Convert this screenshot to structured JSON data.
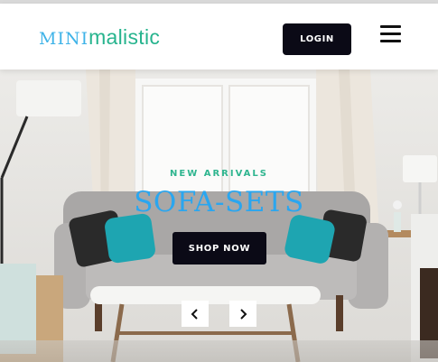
{
  "brand": {
    "logo_part1": "MINI",
    "logo_part2": "malistic"
  },
  "header": {
    "login_label": "LOGIN",
    "menu_icon": "hamburger-menu-icon"
  },
  "hero": {
    "eyebrow": "NEW ARRIVALS",
    "title": "SOFA-SETS",
    "cta_label": "SHOP NOW",
    "prev_icon": "chevron-left-icon",
    "next_icon": "chevron-right-icon"
  },
  "colors": {
    "logo_mini": "#3fb3e8",
    "logo_malistic": "#27b48e",
    "eyebrow": "#2fb58f",
    "title": "#2aa6ef",
    "button_dark": "#0b0a16"
  }
}
